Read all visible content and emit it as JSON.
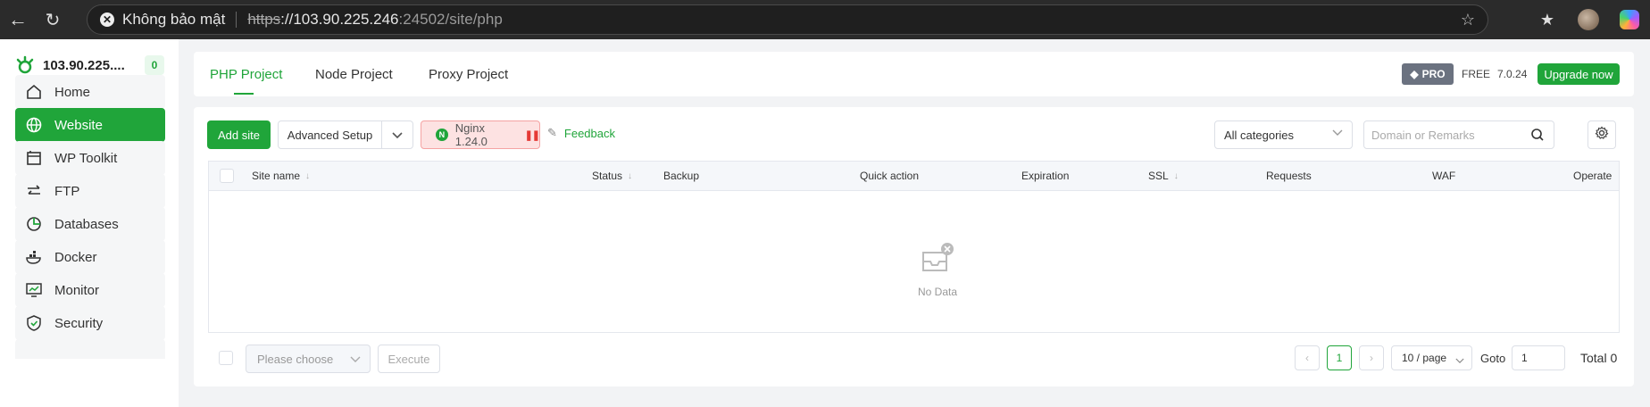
{
  "browser": {
    "security_label": "Không bảo mật",
    "url_scheme": "https",
    "url_host": "://103.90.225.246",
    "url_rest": ":24502/site/php"
  },
  "sidebar": {
    "host": "103.90.225....",
    "badge_count": "0",
    "items": [
      {
        "label": "Home",
        "icon": "home-icon"
      },
      {
        "label": "Website",
        "icon": "globe-icon",
        "active": true
      },
      {
        "label": "WP Toolkit",
        "icon": "wp-toolkit-icon"
      },
      {
        "label": "FTP",
        "icon": "ftp-transfer-icon"
      },
      {
        "label": "Databases",
        "icon": "database-icon"
      },
      {
        "label": "Docker",
        "icon": "docker-icon"
      },
      {
        "label": "Monitor",
        "icon": "monitor-icon"
      },
      {
        "label": "Security",
        "icon": "shield-icon"
      }
    ]
  },
  "tabs": [
    "PHP Project",
    "Node Project",
    "Proxy Project"
  ],
  "header": {
    "pro_label": "PRO",
    "free_label": "FREE",
    "version": "7.0.24",
    "upgrade_label": "Upgrade now"
  },
  "toolbar": {
    "add_site": "Add site",
    "advanced_setup": "Advanced Setup",
    "nginx_label": "Nginx 1.24.0",
    "feedback": "Feedback",
    "category": "All categories",
    "search_placeholder": "Domain or Remarks"
  },
  "table": {
    "columns": [
      "Site name",
      "Status",
      "Backup",
      "Quick action",
      "Expiration",
      "SSL",
      "Requests",
      "WAF",
      "Operate"
    ],
    "rows": [],
    "empty_text": "No Data"
  },
  "footer": {
    "batch_placeholder": "Please choose",
    "execute": "Execute",
    "current_page": "1",
    "page_size": "10 / page",
    "goto_label": "Goto",
    "goto_value": "1",
    "total": "Total 0"
  },
  "colors": {
    "accent": "#20a53a",
    "nginx_bg": "#fde2e2",
    "pro_badge": "#6b7280"
  }
}
